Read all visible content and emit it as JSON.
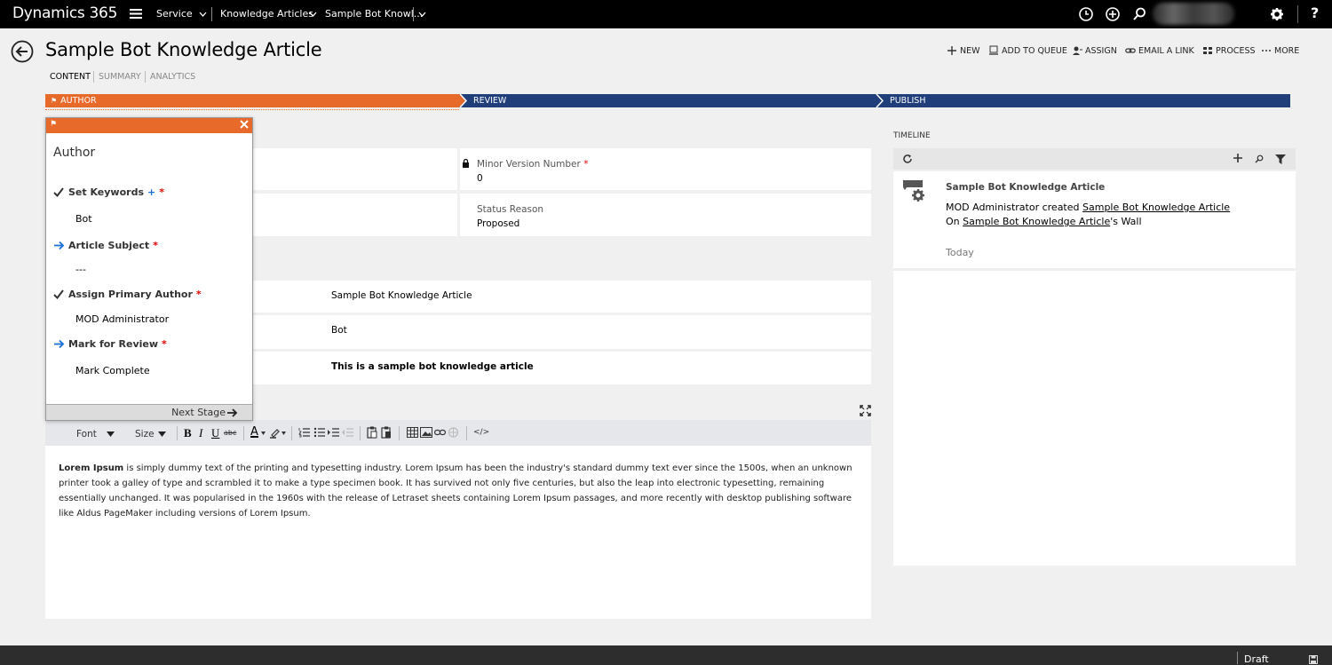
{
  "topbar": {
    "app_title": "Dynamics 365",
    "breadcrumbs": [
      "Service",
      "Knowledge Articles",
      "Sample Bot Knowl..."
    ],
    "icons": [
      "history-icon",
      "add-circle-icon",
      "search-icon",
      "settings-icon",
      "help-icon"
    ],
    "help_label": "?"
  },
  "header": {
    "title": "Sample Bot Knowledge Article",
    "commands": [
      "NEW",
      "ADD TO QUEUE",
      "ASSIGN",
      "EMAIL A LINK",
      "PROCESS",
      "MORE"
    ],
    "tabs": [
      "CONTENT",
      "SUMMARY",
      "ANALYTICS"
    ],
    "active_tab": "CONTENT"
  },
  "process": {
    "stages": [
      "AUTHOR",
      "REVIEW",
      "PUBLISH"
    ],
    "active_stage": "AUTHOR",
    "colors": {
      "active": "#e86a2b",
      "inactive": "#1f3e7a"
    }
  },
  "flyout": {
    "title": "Author",
    "steps": [
      {
        "label": "Set Keywords",
        "value": "Bot",
        "status": "done",
        "multi": "+",
        "required": "*"
      },
      {
        "label": "Article Subject",
        "value": "---",
        "status": "pending",
        "required": "*"
      },
      {
        "label": "Assign Primary Author",
        "value": "MOD Administrator",
        "status": "done",
        "required": "*"
      },
      {
        "label": "Mark for Review",
        "value": "Mark Complete",
        "status": "pending",
        "required": "*"
      }
    ],
    "next_stage": "Next Stage"
  },
  "form": {
    "minor_version": {
      "label": "Minor Version Number",
      "value": "0",
      "required": "*"
    },
    "status_reason": {
      "label": "Status Reason",
      "value": "Proposed"
    },
    "title_value": "Sample Bot Knowledge Article",
    "keywords_value": "Bot",
    "description_value": "This is a sample bot knowledge article"
  },
  "editor": {
    "font_label": "Font",
    "size_label": "Size",
    "bold_lead": "Lorem Ipsum",
    "body": " is simply dummy text of the printing and typesetting industry. Lorem Ipsum has been the industry's standard dummy text ever since the 1500s, when an unknown printer took a galley of type and scrambled it to make a type specimen book. It has survived not only five centuries, but also the leap into electronic typesetting, remaining essentially unchanged. It was popularised in the 1960s with the release of Letraset sheets containing Lorem Ipsum passages, and more recently with desktop publishing software like Aldus PageMaker including versions of Lorem Ipsum."
  },
  "timeline": {
    "label": "TIMELINE",
    "entry": {
      "title": "Sample Bot Knowledge Article",
      "line1_prefix": "MOD Administrator created ",
      "line1_link": "Sample Bot Knowledge Article",
      "line2_prefix": "On ",
      "line2_link": "Sample Bot Knowledge Article",
      "line2_suffix": "'s Wall",
      "time": "Today"
    }
  },
  "statusbar": {
    "status": "Draft"
  }
}
